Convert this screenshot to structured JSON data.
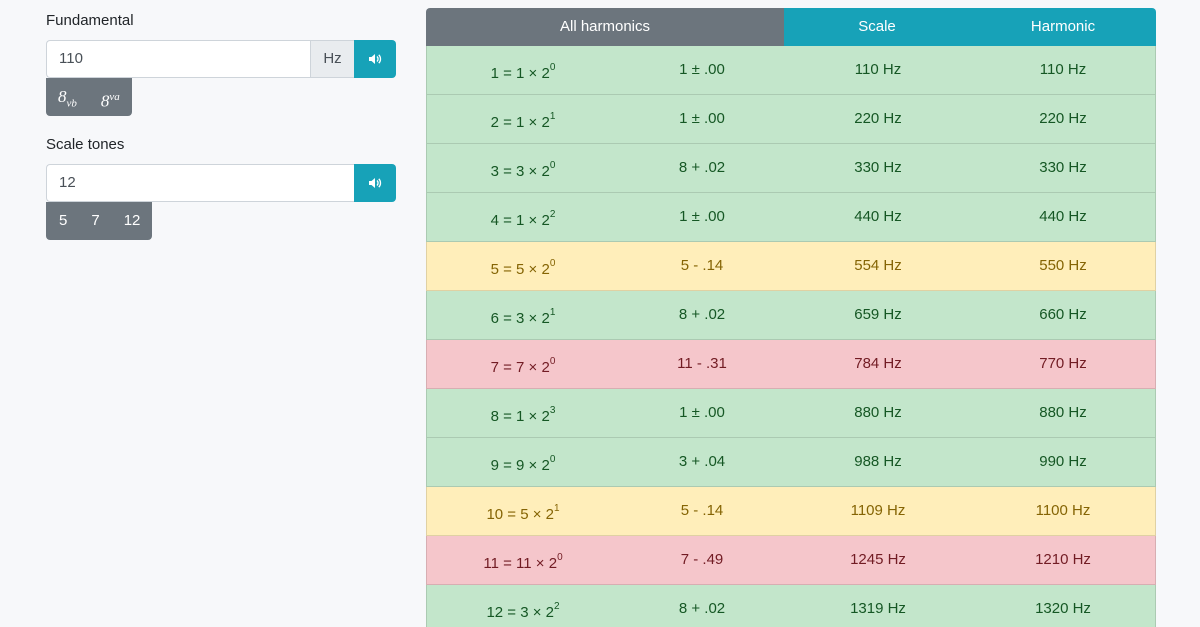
{
  "fundamental": {
    "label": "Fundamental",
    "value": "110",
    "unit": "Hz",
    "octave_buttons": [
      {
        "base": "8",
        "sub": "vb",
        "sup": ""
      },
      {
        "base": "8",
        "sub": "",
        "sup": "va"
      }
    ]
  },
  "scale_tones": {
    "label": "Scale tones",
    "value": "12",
    "presets": [
      "5",
      "7",
      "12"
    ]
  },
  "tabs": [
    "All harmonics",
    "Scale",
    "Harmonic"
  ],
  "colors": {
    "accent": "#17a2b8",
    "secondary": "#6c757d",
    "ok": "#c3e6cb",
    "warn": "#ffeeba",
    "bad": "#f5c6cb"
  },
  "rows": [
    {
      "eq": "1 = 1 × 2",
      "exp": "0",
      "dev": "1 ± .00",
      "scale": "110 Hz",
      "harm": "110 Hz",
      "status": "green"
    },
    {
      "eq": "2 = 1 × 2",
      "exp": "1",
      "dev": "1 ± .00",
      "scale": "220 Hz",
      "harm": "220 Hz",
      "status": "green"
    },
    {
      "eq": "3 = 3 × 2",
      "exp": "0",
      "dev": "8 + .02",
      "scale": "330 Hz",
      "harm": "330 Hz",
      "status": "green"
    },
    {
      "eq": "4 = 1 × 2",
      "exp": "2",
      "dev": "1 ± .00",
      "scale": "440 Hz",
      "harm": "440 Hz",
      "status": "green"
    },
    {
      "eq": "5 = 5 × 2",
      "exp": "0",
      "dev": "5 - .14",
      "scale": "554 Hz",
      "harm": "550 Hz",
      "status": "yellow"
    },
    {
      "eq": "6 = 3 × 2",
      "exp": "1",
      "dev": "8 + .02",
      "scale": "659 Hz",
      "harm": "660 Hz",
      "status": "green"
    },
    {
      "eq": "7 = 7 × 2",
      "exp": "0",
      "dev": "11 - .31",
      "scale": "784 Hz",
      "harm": "770 Hz",
      "status": "red"
    },
    {
      "eq": "8 = 1 × 2",
      "exp": "3",
      "dev": "1 ± .00",
      "scale": "880 Hz",
      "harm": "880 Hz",
      "status": "green"
    },
    {
      "eq": "9 = 9 × 2",
      "exp": "0",
      "dev": "3 + .04",
      "scale": "988 Hz",
      "harm": "990 Hz",
      "status": "green"
    },
    {
      "eq": "10 = 5 × 2",
      "exp": "1",
      "dev": "5 - .14",
      "scale": "1109 Hz",
      "harm": "1100 Hz",
      "status": "yellow"
    },
    {
      "eq": "11 = 11 × 2",
      "exp": "0",
      "dev": "7 - .49",
      "scale": "1245 Hz",
      "harm": "1210 Hz",
      "status": "red"
    },
    {
      "eq": "12 = 3 × 2",
      "exp": "2",
      "dev": "8 + .02",
      "scale": "1319 Hz",
      "harm": "1320 Hz",
      "status": "green"
    }
  ]
}
